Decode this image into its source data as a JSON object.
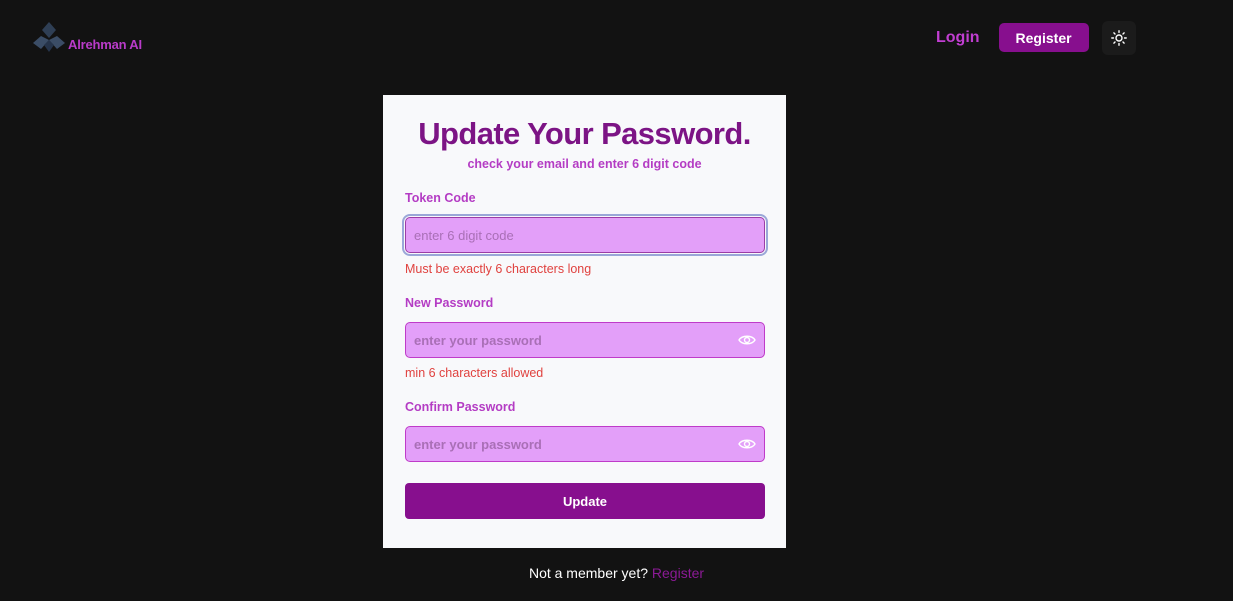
{
  "header": {
    "logo_text": "Alrehman AI",
    "login_label": "Login",
    "register_label": "Register",
    "theme_icon": "sun-icon"
  },
  "card": {
    "title": "Update Your Password.",
    "subtitle": "check your email and enter 6 digit code",
    "token": {
      "label": "Token Code",
      "placeholder": "enter 6 digit code",
      "value": "",
      "error": "Must be exactly 6 characters long"
    },
    "new_password": {
      "label": "New Password",
      "placeholder": "enter your password",
      "value": "",
      "error": "min 6 characters allowed",
      "icon": "eye-icon"
    },
    "confirm_password": {
      "label": "Confirm Password",
      "placeholder": "enter your password",
      "value": "",
      "icon": "eye-icon"
    },
    "submit_label": "Update"
  },
  "footer": {
    "prompt": "Not a member yet?",
    "register_link": "Register"
  },
  "colors": {
    "background": "#121212",
    "accent": "#870f8e",
    "accent_text": "#b43cc4",
    "input_bg": "#e39ff9",
    "error": "#e0423f"
  }
}
